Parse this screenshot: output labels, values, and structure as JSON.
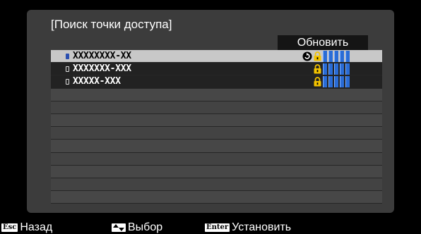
{
  "dialog": {
    "title": "[Поиск точки доступа]",
    "refresh_label": "Обновить"
  },
  "networks": [
    {
      "ssid": "XXXXXXXX-XX",
      "selected": true,
      "connected": true,
      "locked": true,
      "signal_bars": 5
    },
    {
      "ssid": "XXXXXXX-XXX",
      "selected": false,
      "connected": false,
      "locked": true,
      "signal_bars": 5
    },
    {
      "ssid": "XXXXX-XXX",
      "selected": false,
      "connected": false,
      "locked": true,
      "signal_bars": 5
    }
  ],
  "empty_rows": 9,
  "footer": {
    "back_key": "Esc",
    "back_label": "Назад",
    "select_key_icon": "up-down-arrows-icon",
    "select_label": "Выбор",
    "enter_key": "Enter",
    "enter_label": "Установить"
  },
  "colors": {
    "panel": "#3c3c3c",
    "selected_row": "#c8c8c8",
    "lock": "#f2c200",
    "signal": "#2a6cd6"
  }
}
